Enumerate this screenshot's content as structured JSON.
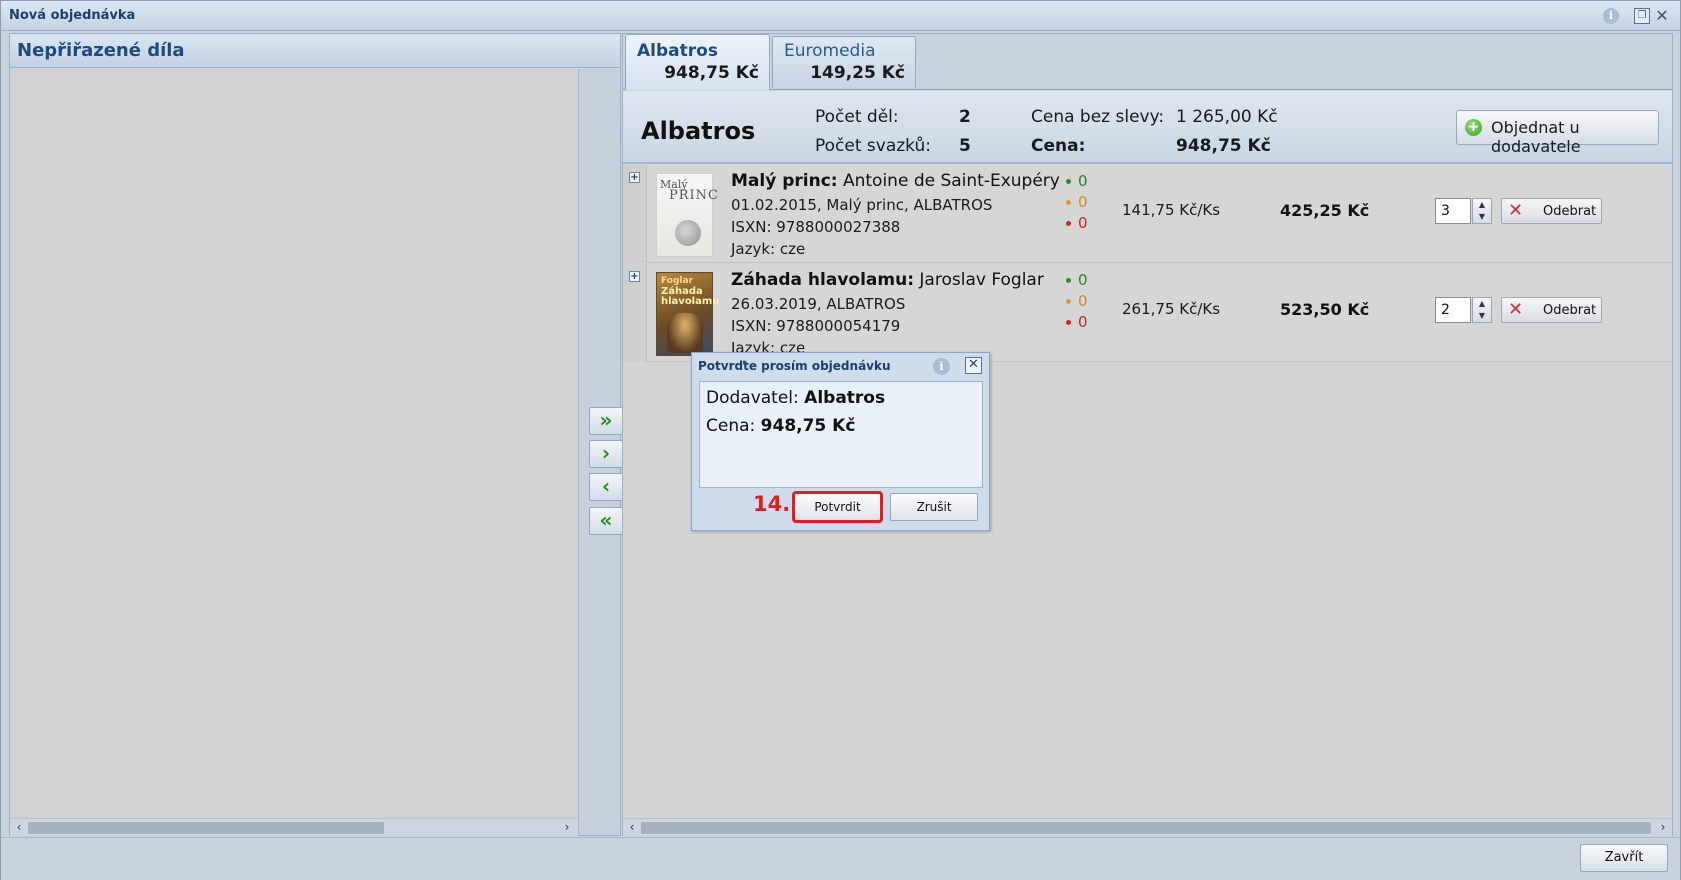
{
  "window": {
    "title": "Nová objednávka"
  },
  "left_panel": {
    "title": "Nepřiřazené díla"
  },
  "transfer": {
    "all_right": "»",
    "right": "›",
    "left": "‹",
    "all_left": "«"
  },
  "tabs": [
    {
      "name": "Albatros",
      "price": "948,75 Kč"
    },
    {
      "name": "Euromedia",
      "price": "149,25 Kč"
    }
  ],
  "summary": {
    "supplier": "Albatros",
    "count_works_label": "Počet děl:",
    "count_works_value": "2",
    "count_volumes_label": "Počet svazků:",
    "count_volumes_value": "5",
    "price_nodiscount_label": "Cena bez slevy:",
    "price_nodiscount_value": "1 265,00 Kč",
    "price_label": "Cena:",
    "price_value": "948,75 Kč",
    "order_button": "Objednat u dodavatele"
  },
  "rows": [
    {
      "title": "Malý princ:",
      "author": " Antoine de Saint-Exupéry",
      "line1": "01.02.2015, Malý princ, ALBATROS",
      "line2": "ISXN: 9788000027388",
      "line3": "Jazyk: cze",
      "cover_text1": "Malý",
      "cover_text2": "PRINC",
      "stock_green": "0",
      "stock_orange": "0",
      "stock_red": "0",
      "unit_price": "141,75 Kč/Ks",
      "total": "425,25 Kč",
      "qty": "3",
      "remove": "Odebrat"
    },
    {
      "title": "Záhada hlavolamu:",
      "author": " Jaroslav Foglar",
      "line1": "26.03.2019, ALBATROS",
      "line2": "ISXN: 9788000054179",
      "line3": "Jazyk: cze",
      "cover_text1": "Foglar",
      "cover_text2": "Záhada hlavolamu",
      "stock_green": "0",
      "stock_orange": "0",
      "stock_red": "0",
      "unit_price": "261,75 Kč/Ks",
      "total": "523,50 Kč",
      "qty": "2",
      "remove": "Odebrat"
    }
  ],
  "dialog": {
    "title": "Potvrďte prosím objednávku",
    "supplier_label": "Dodavatel: ",
    "supplier_value": "Albatros",
    "price_label": "Cena: ",
    "price_value": "948,75 Kč",
    "step": "14.",
    "confirm": "Potvrdit",
    "cancel": "Zrušit"
  },
  "footer": {
    "close": "Zavřít"
  },
  "icons": {
    "info": "info-icon",
    "restore": "restore-icon",
    "close": "close-icon",
    "add": "plus-circle-icon",
    "remove": "x-icon"
  },
  "colors": {
    "accent": "#1d4a85",
    "highlight": "#e01e1e",
    "plus": "#3a9c24"
  }
}
